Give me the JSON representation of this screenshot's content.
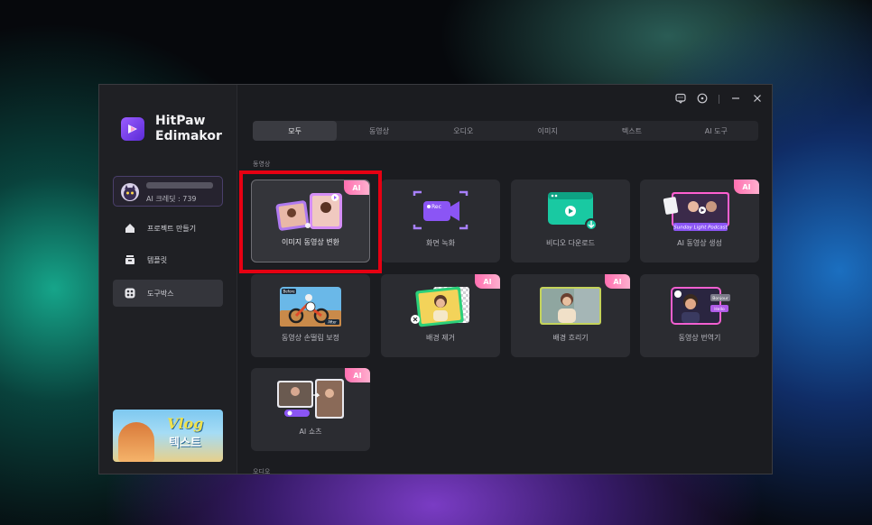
{
  "app": {
    "name_line1": "HitPaw",
    "name_line2": "Edimakor"
  },
  "user": {
    "credit": "AI 크레딧 : 739"
  },
  "sidebar": {
    "items": [
      {
        "label": "프로젝트 만들기",
        "icon": "home-icon"
      },
      {
        "label": "템플릿",
        "icon": "template-icon"
      },
      {
        "label": "도구박스",
        "icon": "toolbox-icon",
        "active": true
      }
    ]
  },
  "promo": {
    "title": "Vlog",
    "subtitle": "텍스트"
  },
  "tabs": [
    {
      "label": "모두",
      "active": true
    },
    {
      "label": "동영상"
    },
    {
      "label": "오디오"
    },
    {
      "label": "이미지"
    },
    {
      "label": "텍스트"
    },
    {
      "label": "AI 도구"
    }
  ],
  "sections": {
    "video": "동영상",
    "audio": "오디오"
  },
  "tools": [
    {
      "label": "이미지 동영상 변환",
      "ai": true,
      "selected": true
    },
    {
      "label": "화면 녹화",
      "ai": false,
      "rec_text": "Rec"
    },
    {
      "label": "비디오 다운로드",
      "ai": false
    },
    {
      "label": "AI 동영상 생성",
      "ai": true,
      "banner": "Sunday Light Podcast"
    },
    {
      "label": "동영상 손떨림 보정",
      "ai": false,
      "before": "Before",
      "after": "After"
    },
    {
      "label": "배경 제거",
      "ai": true
    },
    {
      "label": "배경 흐리기",
      "ai": true
    },
    {
      "label": "동영상 번역기",
      "ai": false,
      "bubble1": "Bonjour",
      "bubble2": "Hello"
    },
    {
      "label": "AI 쇼츠",
      "ai": true
    }
  ],
  "ai_badge": "AI",
  "colors": {
    "accent": "#9a5cff",
    "highlight": "#e60012",
    "ai_badge": "#ff6fb0"
  }
}
